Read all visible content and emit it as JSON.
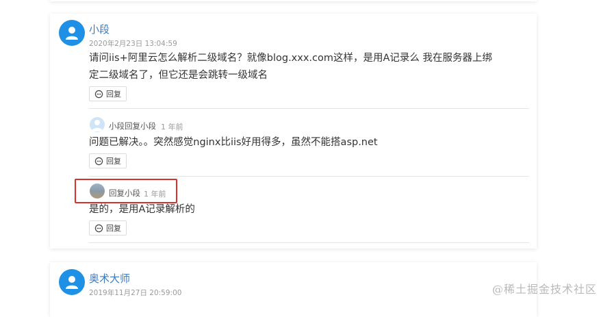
{
  "comments": [
    {
      "author": "小段",
      "time": "2020年2月23日 13:04:59",
      "content_line1": "请问iis+阿里云怎么解析二级域名？就像blog.xxx.com这样，是用A记录么 我在服务器上绑",
      "content_line2": "定二级域名了，但它还是会跳转一级域名",
      "reply_label": "回复",
      "replies": [
        {
          "header": "小段回复小段",
          "time": "1 年前",
          "content": "问题已解决。。突然感觉nginx比iis好用得多，虽然不能搭asp.net",
          "reply_label": "回复"
        },
        {
          "header": "回复小段",
          "time": "1 年前",
          "content": "是的，是用A记录解析的",
          "reply_label": "回复"
        }
      ]
    },
    {
      "author": "奥术大师",
      "time": "2019年11月27日 20:59:00"
    }
  ],
  "watermark": "@稀土掘金技术社区",
  "colors": {
    "accent": "#1e90e6",
    "name": "#3b7bbf",
    "highlight": "#d9302c"
  },
  "icons": {
    "avatar": "user-icon",
    "reply": "chat-bubble-icon"
  }
}
